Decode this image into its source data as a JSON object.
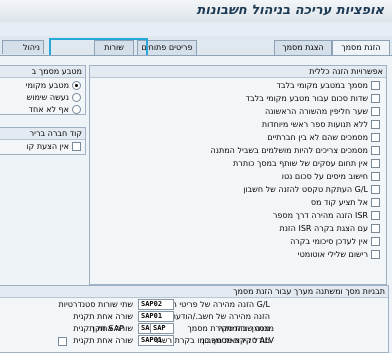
{
  "window": {
    "title": "אופציות עריכה בניהול חשבונות"
  },
  "tabs": [
    {
      "label": "הזנת מסמך"
    },
    {
      "label": "הצגת מסמך"
    },
    {
      "label": "פריטים פתוחים"
    },
    {
      "label": "שורות"
    },
    {
      "label": "ניהול"
    }
  ],
  "general": {
    "title": "אפשרויות הזנה כללית",
    "options": [
      "מסמך במטבע מקומי בלבד",
      "שדות סכום עבור מטבע מקומי בלבד",
      "שער חליפין מהשורה הראשונה",
      "ללא תנועות ספר ראשי מיוחדות",
      "מסמכים שהם לא בין חברתיים",
      "מסמכים צריכים להיות מושלמים בשביל המתנה",
      "אין תחום עסקים של שותף במסך כותרת",
      "חישוב מיסים על סכום נטו",
      "העתקת טקסט להזנה של חשבון G/L",
      "אל תציע קוד מס",
      "הזנה מהירה דרך מספר ISR",
      "הזנת ISR עם הצגת בקרה",
      "אין לעדכן סיכומי בקרה",
      "רישום שלילי אוטומטי"
    ]
  },
  "currency": {
    "title": "מטבע מסמך ב",
    "options": [
      {
        "label": "מטבע מקומי",
        "selected": true
      },
      {
        "label": "נעשה שימוש",
        "selected": false
      },
      {
        "label": "אף לא אחד",
        "selected": false
      }
    ]
  },
  "company": {
    "title": "קוד חברה בריר",
    "option": "אין הצעת קו"
  },
  "templates": {
    "title": "תבניות מסך ומשתנה מערך עבור הזנת מסמך",
    "rows": [
      {
        "label": "הזנה מהירה של פריטי חשבון G/L",
        "value": "SAP02",
        "desc": "שתי שורות סטנדרטיות"
      },
      {
        "label": "הזנה מהירה של חשב./הודעת זיכוי",
        "value": "SAP01",
        "desc": "שורה אחת תקנית"
      },
      {
        "label": "מסמך בהמתנה",
        "value": "SAP01",
        "desc": "שורה אחת תקנית"
      },
      {
        "label": "מודל הקצאת חשבון",
        "value": "SAP01",
        "desc": "שורה אחת תקנית"
      },
      {
        "label": "מבנה שורת סקירת מסמך",
        "value": "SAP",
        "desc": "תקן SAP"
      }
    ],
    "alv_label": "סקירת מסמך כמו בקרת רשת ALV"
  }
}
